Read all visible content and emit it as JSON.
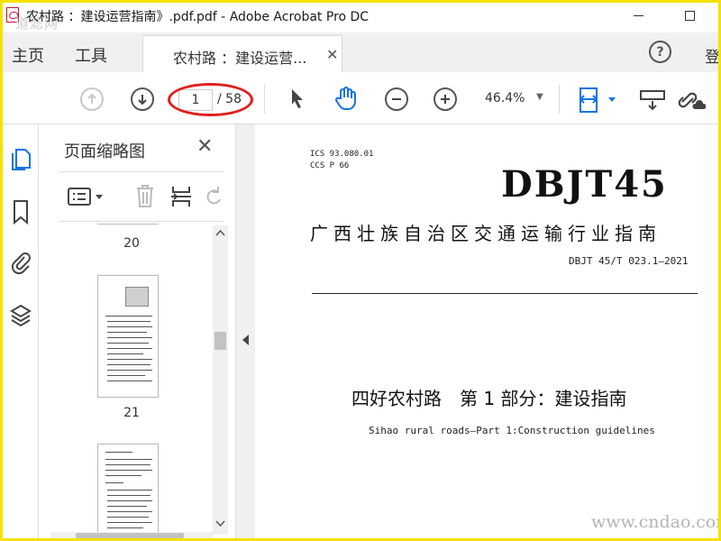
{
  "window": {
    "title": "农村路 ：建设运营指南》.pdf.pdf - Adobe Acrobat Pro DC",
    "watermark_top": "道滤网"
  },
  "menu": {
    "home": "主页",
    "tools": "工具",
    "doc_tab": "农村路 ：建设运营...",
    "login": "登"
  },
  "toolbar": {
    "page_current": "1",
    "page_total": "/ 58",
    "zoom": "46.4%",
    "accent": "#1473e6",
    "annotation_color": "#e0201f"
  },
  "panel": {
    "title": "页面缩略图",
    "thumbs": [
      {
        "label": "20"
      },
      {
        "label": "21"
      }
    ]
  },
  "document": {
    "ics": "ICS 93.080.01",
    "ccs": "CCS P 66",
    "logo": "DBJT45",
    "region": "广西壮族自治区交通运输行业指南",
    "std_number": "DBJT 45/T 023.1—2021",
    "title_cn": "四好农村路　第 1 部分：建设指南",
    "title_en": "Sihao rural roads—Part 1:Construction guidelines",
    "watermark": "www.cndao.com"
  }
}
